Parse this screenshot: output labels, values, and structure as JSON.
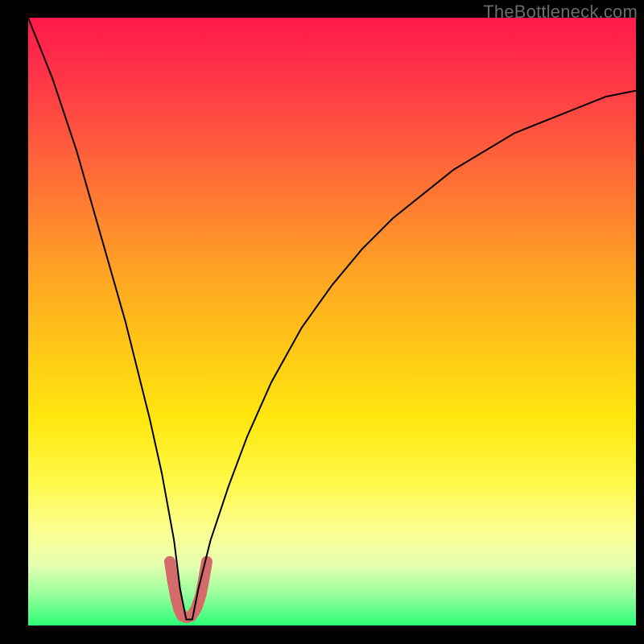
{
  "watermark": "TheBottleneck.com",
  "chart_data": {
    "type": "line",
    "title": "",
    "xlabel": "",
    "ylabel": "",
    "xlim": [
      0,
      100
    ],
    "ylim": [
      0,
      100
    ],
    "legend": false,
    "grid": false,
    "background_gradient": {
      "top": "#ff1a49",
      "mid": "#ffe70f",
      "bottom": "#2cff77"
    },
    "series": [
      {
        "name": "bottleneck-curve",
        "color": "#000000",
        "stroke_width": 2,
        "x": [
          0,
          2,
          4,
          6,
          8,
          10,
          12,
          14,
          16,
          18,
          20,
          22,
          24,
          25,
          26,
          27,
          28,
          30,
          33,
          36,
          40,
          45,
          50,
          55,
          60,
          65,
          70,
          75,
          80,
          85,
          90,
          95,
          100
        ],
        "values": [
          100,
          95,
          90,
          84,
          78,
          71,
          64,
          57,
          50,
          42,
          34,
          25,
          14,
          6,
          1,
          1,
          6,
          14,
          23,
          31,
          40,
          49,
          56,
          62,
          67,
          71,
          75,
          78,
          81,
          83,
          85,
          87,
          88
        ]
      },
      {
        "name": "sweet-spot-u",
        "color": "#d46a6a",
        "stroke_width": 14,
        "linecap": "round",
        "x": [
          23.3,
          23.8,
          24.3,
          24.8,
          25.3,
          26.1,
          26.9,
          27.7,
          28.4,
          28.9,
          29.4
        ],
        "values": [
          10.5,
          7.3,
          4.6,
          2.7,
          1.6,
          1.3,
          1.6,
          2.9,
          5.0,
          7.6,
          10.5
        ]
      }
    ]
  }
}
